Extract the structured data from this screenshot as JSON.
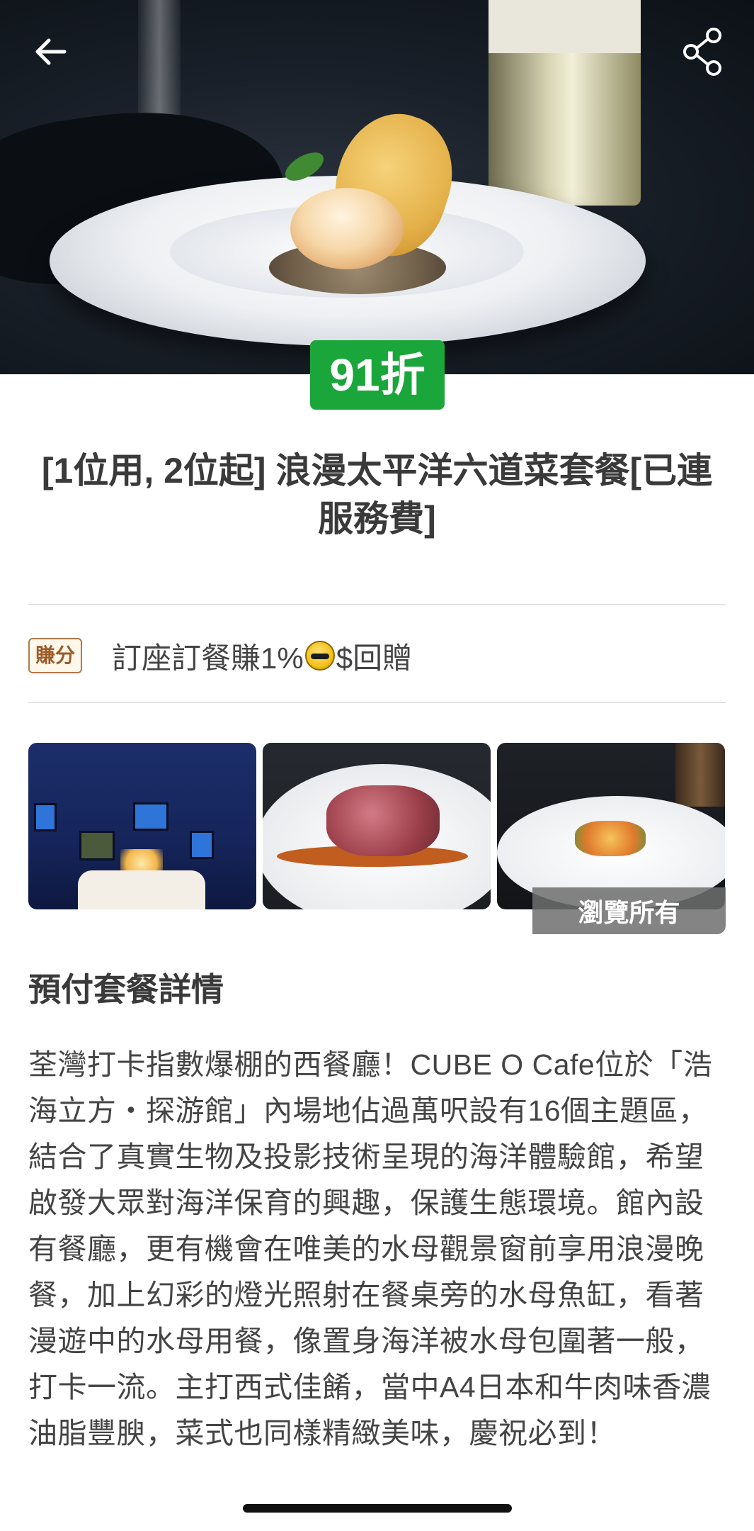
{
  "header": {
    "back_icon": "arrow-left-icon",
    "share_icon": "share-icon"
  },
  "hero": {
    "discount_label": "91折"
  },
  "product": {
    "title": "[1位用, 2位起] 浪漫太平洋六道菜套餐[已連服務費]"
  },
  "points": {
    "tag": "賺分",
    "text_before": "訂座訂餐賺1%",
    "coin_icon": "coin-icon",
    "text_after": "$回贈"
  },
  "gallery": {
    "browse_all_label": "瀏覽所有"
  },
  "details": {
    "section_title": "預付套餐詳情",
    "description": "荃灣打卡指數爆棚的西餐廳！CUBE O Cafe位於「浩海立方・探游館」內場地佔過萬呎設有16個主題區，結合了真實生物及投影技術呈現的海洋體驗館，希望啟發大眾對海洋保育的興趣，保護生態環境。館內設有餐廳，更有機會在唯美的水母觀景窗前享用浪漫晚餐，加上幻彩的燈光照射在餐桌旁的水母魚缸，看著漫遊中的水母用餐，像置身海洋被水母包圍著一般，打卡一流。主打西式佳餚，當中A4日本和牛肉味香濃油脂豐腴，菜式也同樣精緻美味，慶祝必到！"
  },
  "colors": {
    "discount_green": "#1aa63a",
    "points_brown": "#b07a4a"
  }
}
